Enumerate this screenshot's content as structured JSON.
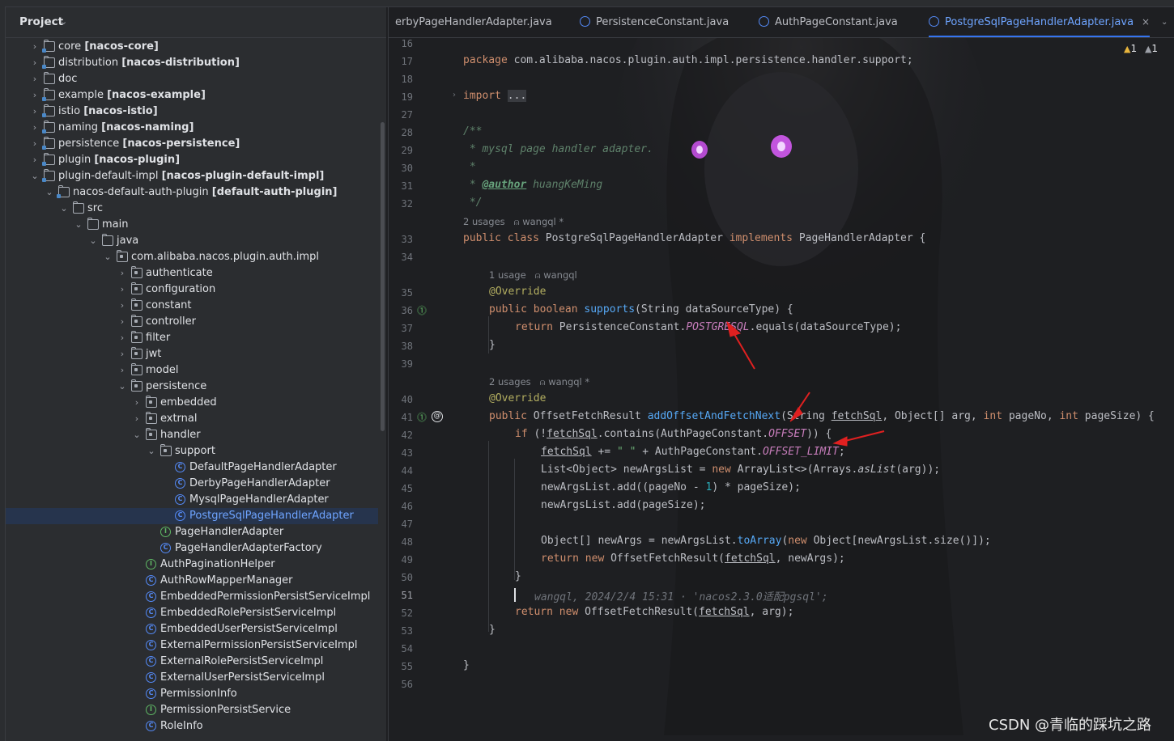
{
  "project_panel": {
    "title": "Project",
    "tree": [
      {
        "label": "core",
        "module": "[nacos-core]",
        "kind": "module",
        "depth": 0,
        "expanded": false
      },
      {
        "label": "distribution",
        "module": "[nacos-distribution]",
        "kind": "module",
        "depth": 0,
        "expanded": false
      },
      {
        "label": "doc",
        "module": "",
        "kind": "folder",
        "depth": 0,
        "expanded": false
      },
      {
        "label": "example",
        "module": "[nacos-example]",
        "kind": "module",
        "depth": 0,
        "expanded": false
      },
      {
        "label": "istio",
        "module": "[nacos-istio]",
        "kind": "module",
        "depth": 0,
        "expanded": false
      },
      {
        "label": "naming",
        "module": "[nacos-naming]",
        "kind": "module",
        "depth": 0,
        "expanded": false
      },
      {
        "label": "persistence",
        "module": "[nacos-persistence]",
        "kind": "module",
        "depth": 0,
        "expanded": false
      },
      {
        "label": "plugin",
        "module": "[nacos-plugin]",
        "kind": "module",
        "depth": 0,
        "expanded": false
      },
      {
        "label": "plugin-default-impl",
        "module": "[nacos-plugin-default-impl]",
        "kind": "module",
        "depth": 0,
        "expanded": true
      },
      {
        "label": "nacos-default-auth-plugin",
        "module": "[default-auth-plugin]",
        "kind": "module",
        "depth": 1,
        "expanded": true
      },
      {
        "label": "src",
        "module": "",
        "kind": "folder",
        "depth": 2,
        "expanded": true
      },
      {
        "label": "main",
        "module": "",
        "kind": "folder",
        "depth": 3,
        "expanded": true
      },
      {
        "label": "java",
        "module": "",
        "kind": "folder",
        "depth": 4,
        "expanded": true
      },
      {
        "label": "com.alibaba.nacos.plugin.auth.impl",
        "module": "",
        "kind": "package",
        "depth": 5,
        "expanded": true
      },
      {
        "label": "authenticate",
        "module": "",
        "kind": "package",
        "depth": 6,
        "expanded": false
      },
      {
        "label": "configuration",
        "module": "",
        "kind": "package",
        "depth": 6,
        "expanded": false
      },
      {
        "label": "constant",
        "module": "",
        "kind": "package",
        "depth": 6,
        "expanded": false
      },
      {
        "label": "controller",
        "module": "",
        "kind": "package",
        "depth": 6,
        "expanded": false
      },
      {
        "label": "filter",
        "module": "",
        "kind": "package",
        "depth": 6,
        "expanded": false
      },
      {
        "label": "jwt",
        "module": "",
        "kind": "package",
        "depth": 6,
        "expanded": false
      },
      {
        "label": "model",
        "module": "",
        "kind": "package",
        "depth": 6,
        "expanded": false
      },
      {
        "label": "persistence",
        "module": "",
        "kind": "package",
        "depth": 6,
        "expanded": true
      },
      {
        "label": "embedded",
        "module": "",
        "kind": "package",
        "depth": 7,
        "expanded": false
      },
      {
        "label": "extrnal",
        "module": "",
        "kind": "package",
        "depth": 7,
        "expanded": false
      },
      {
        "label": "handler",
        "module": "",
        "kind": "package",
        "depth": 7,
        "expanded": true
      },
      {
        "label": "support",
        "module": "",
        "kind": "package",
        "depth": 8,
        "expanded": true
      },
      {
        "label": "DefaultPageHandlerAdapter",
        "module": "",
        "kind": "class",
        "depth": 9
      },
      {
        "label": "DerbyPageHandlerAdapter",
        "module": "",
        "kind": "class",
        "depth": 9
      },
      {
        "label": "MysqlPageHandlerAdapter",
        "module": "",
        "kind": "class",
        "depth": 9
      },
      {
        "label": "PostgreSqlPageHandlerAdapter",
        "module": "",
        "kind": "class",
        "depth": 9,
        "selected": true
      },
      {
        "label": "PageHandlerAdapter",
        "module": "",
        "kind": "interface",
        "depth": 8
      },
      {
        "label": "PageHandlerAdapterFactory",
        "module": "",
        "kind": "class",
        "depth": 8
      },
      {
        "label": "AuthPaginationHelper",
        "module": "",
        "kind": "interface",
        "depth": 7
      },
      {
        "label": "AuthRowMapperManager",
        "module": "",
        "kind": "class",
        "depth": 7
      },
      {
        "label": "EmbeddedPermissionPersistServiceImpl",
        "module": "",
        "kind": "class",
        "depth": 7
      },
      {
        "label": "EmbeddedRolePersistServiceImpl",
        "module": "",
        "kind": "class",
        "depth": 7
      },
      {
        "label": "EmbeddedUserPersistServiceImpl",
        "module": "",
        "kind": "class",
        "depth": 7
      },
      {
        "label": "ExternalPermissionPersistServiceImpl",
        "module": "",
        "kind": "class",
        "depth": 7
      },
      {
        "label": "ExternalRolePersistServiceImpl",
        "module": "",
        "kind": "class",
        "depth": 7
      },
      {
        "label": "ExternalUserPersistServiceImpl",
        "module": "",
        "kind": "class",
        "depth": 7
      },
      {
        "label": "PermissionInfo",
        "module": "",
        "kind": "class",
        "depth": 7
      },
      {
        "label": "PermissionPersistService",
        "module": "",
        "kind": "interface",
        "depth": 7
      },
      {
        "label": "RoleInfo",
        "module": "",
        "kind": "class",
        "depth": 7
      }
    ]
  },
  "editor": {
    "tabs": [
      {
        "label": "erbyPageHandlerAdapter.java",
        "icon": "class-icon",
        "active": false
      },
      {
        "label": "PersistenceConstant.java",
        "icon": "class-icon",
        "active": false
      },
      {
        "label": "AuthPageConstant.java",
        "icon": "class-icon",
        "active": false
      },
      {
        "label": "PostgreSqlPageHandlerAdapter.java",
        "icon": "class-icon",
        "active": true
      }
    ],
    "close_glyph": "×",
    "more_glyph": "⌄",
    "warnings": {
      "warning_count": "1",
      "weak_warning_count": "1"
    },
    "line_numbers": [
      "16",
      "17",
      "18",
      "19",
      "27",
      "28",
      "29",
      "30",
      "31",
      "32",
      "33",
      "34",
      "35",
      "36",
      "37",
      "38",
      "39",
      "40",
      "41",
      "42",
      "43",
      "44",
      "45",
      "46",
      "47",
      "48",
      "49",
      "50",
      "51",
      "52",
      "53",
      "54",
      "55",
      "56"
    ],
    "current_line": "51",
    "hints": {
      "class_usages": "2 usages",
      "class_author": "wangql *",
      "m1_usages": "1 usage",
      "m1_author": "wangql",
      "m2_usages": "2 usages",
      "m2_author": "wangql *"
    },
    "code": {
      "package_kw": "package",
      "package_name": "com.alibaba.nacos.plugin.auth.impl.persistence.handler.support;",
      "import_kw": "import",
      "import_fold": "...",
      "doc_open": "/**",
      "doc_line1": " * mysql page handler adapter.",
      "doc_line2": " *",
      "doc_author_prefix": " * ",
      "doc_author_tag": "@author",
      "doc_author_name": " huangKeMing",
      "doc_close": " */",
      "class_decl_kw": "public class ",
      "class_name": "PostgreSqlPageHandlerAdapter ",
      "implements_kw": "implements ",
      "iface": "PageHandlerAdapter {",
      "override": "@Override",
      "m1_kw": "public boolean ",
      "m1_name": "supports",
      "m1_params": "(String dataSourceType) {",
      "m1_return_kw": "return ",
      "m1_return_obj": "PersistenceConstant.",
      "m1_const": "POSTGRESQL",
      "m1_return_rest": ".equals(dataSourceType);",
      "close_brace": "}",
      "m2_kw": "public ",
      "m2_type": "OffsetFetchResult ",
      "m2_name": "addOffsetAndFetchNext",
      "m2_params_a": "(String ",
      "m2_p1": "fetchSql",
      "m2_params_b": ", Object[] arg, ",
      "m2_int1": "int",
      "m2_params_c": " pageNo, ",
      "m2_int2": "int",
      "m2_params_d": " pageSize) {",
      "if_kw": "if ",
      "if_a": "(!",
      "if_var": "fetchSql",
      "if_b": ".contains(AuthPageConstant.",
      "if_const": "OFFSET",
      "if_c": ")) {",
      "l43_var": "fetchSql",
      "l43_a": " += ",
      "l43_str": "\" \"",
      "l43_b": " + AuthPageConstant.",
      "l43_const": "OFFSET_LIMIT",
      "l43_c": ";",
      "l44_a": "List<Object> newArgsList = ",
      "l44_new": "new ",
      "l44_b": "ArrayList<>(Arrays.",
      "l44_static": "asList",
      "l44_c": "(arg));",
      "l45_a": "newArgsList.add((pageNo - ",
      "l45_num": "1",
      "l45_b": ") * pageSize);",
      "l46": "newArgsList.add(pageSize);",
      "l48_a": "Object[] newArgs = newArgsList.",
      "l48_fn": "toArray",
      "l48_b": "(",
      "l48_new": "new ",
      "l48_c": "Object[newArgsList.size()]);",
      "l49_ret": "return ",
      "l49_new": "new ",
      "l49_a": "OffsetFetchResult(",
      "l49_var": "fetchSql",
      "l49_b": ", newArgs);",
      "blame": "wangql, 2024/2/4 15:31 · 'nacos2.3.0适配pgsql';",
      "l52_ret": "return ",
      "l52_new": "new ",
      "l52_a": "OffsetFetchResult(",
      "l52_var": "fetchSql",
      "l52_b": ", arg);"
    }
  },
  "watermark": "CSDN @青临的踩坑之路",
  "colors": {
    "background": "#1e1f22",
    "panel": "#2b2d30",
    "keyword": "#cf8e6d",
    "annotation": "#b3ae60",
    "method": "#56a8f5",
    "constant": "#c77dbb",
    "selected_text": "#6ea4ff",
    "red_arrow": "#e02020"
  }
}
